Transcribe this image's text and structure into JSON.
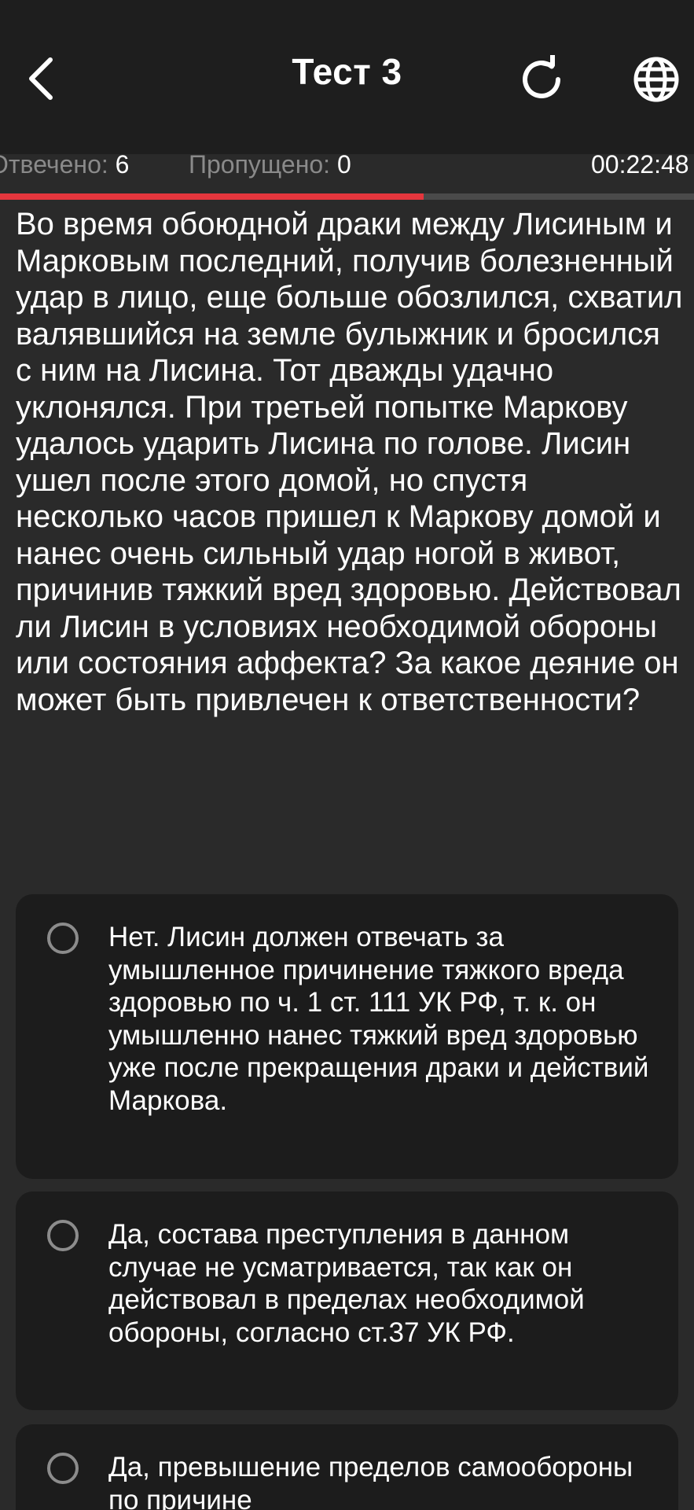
{
  "header": {
    "title": "Тест 3",
    "back_icon": "chevron-left-icon",
    "reload_icon": "reload-icon",
    "language_icon": "globe-icon"
  },
  "stats": {
    "answered_label": "Отвечено:",
    "answered_value": "6",
    "skipped_label": "Пропущено:",
    "skipped_value": "0",
    "timer": "00:22:48"
  },
  "progress": {
    "fraction": 0.61
  },
  "question": {
    "text": "Во время обоюдной драки между Лисиным и Марковым последний, получив болезненный удар в лицо, еще больше обозлился, схватил валявшийся на земле булыжник и бросился с ним на Лисина. Тот дважды удачно уклонялся. При третьей попытке Маркову удалось ударить Лисина по голове. Лисин ушел после этого домой, но спустя несколько часов пришел к Маркову домой и нанес очень сильный удар ногой в живот, причинив тяжкий вред здоровью. Действовал ли Лисин в условиях необходимой обороны или состояния аффекта? За какое деяние он может быть привлечен к ответственности?"
  },
  "options": [
    {
      "text": "Нет. Лисин должен отвечать за умышленное причинение тяжкого вреда здоровью по ч. 1 ст. 111 УК РФ, т. к. он умышленно нанес тяжкий вред здоровью уже после прекращения драки и действий Маркова."
    },
    {
      "text": "Да, состава преступления в данном случае не усматривается, так как он действовал в пределах необходимой обороны, согласно ст.37 УК РФ."
    },
    {
      "text": "Да, превышение пределов самообороны по причине"
    }
  ],
  "colors": {
    "background": "#2a2a2a",
    "header": "#1e1e1e",
    "card": "#1c1c1c",
    "accent": "#e5363d",
    "muted_text": "#8a8a8a"
  }
}
